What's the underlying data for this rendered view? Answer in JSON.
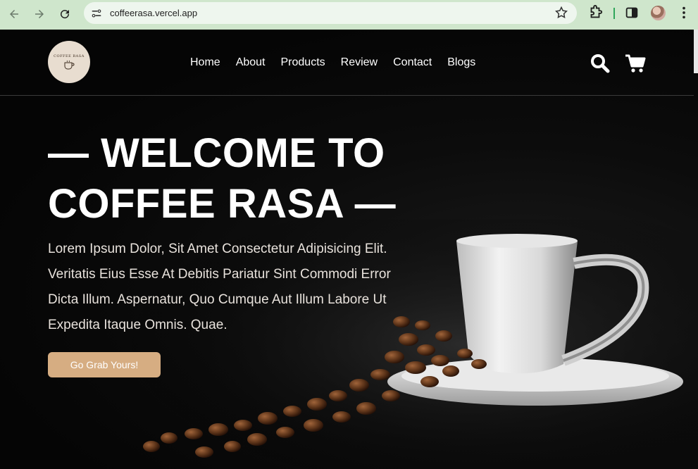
{
  "browser": {
    "url": "coffeerasa.vercel.app",
    "icons": [
      "back-icon",
      "forward-icon",
      "reload-icon",
      "site-info-icon",
      "star-icon",
      "extensions-icon",
      "side-panel-icon",
      "profile-avatar",
      "more-menu-icon"
    ]
  },
  "site": {
    "logo_text": "COFFEE RASA",
    "nav": [
      "Home",
      "About",
      "Products",
      "Review",
      "Contact",
      "Blogs"
    ],
    "hero": {
      "title_line1": "— WELCOME TO",
      "title_line2": "COFFEE RASA —",
      "paragraph": "Lorem Ipsum Dolor, Sit Amet Consectetur Adipisicing Elit. Veritatis Eius Esse At Debitis Pariatur Sint Commodi Error Dicta Illum. Aspernatur, Quo Cumque Aut Illum Labore Ut Expedita Itaque Omnis. Quae.",
      "cta": "Go Grab Yours!"
    }
  },
  "colors": {
    "chrome_bg": "#cfe6cc",
    "accent": "#d6ad82",
    "page_bg": "#000000"
  }
}
